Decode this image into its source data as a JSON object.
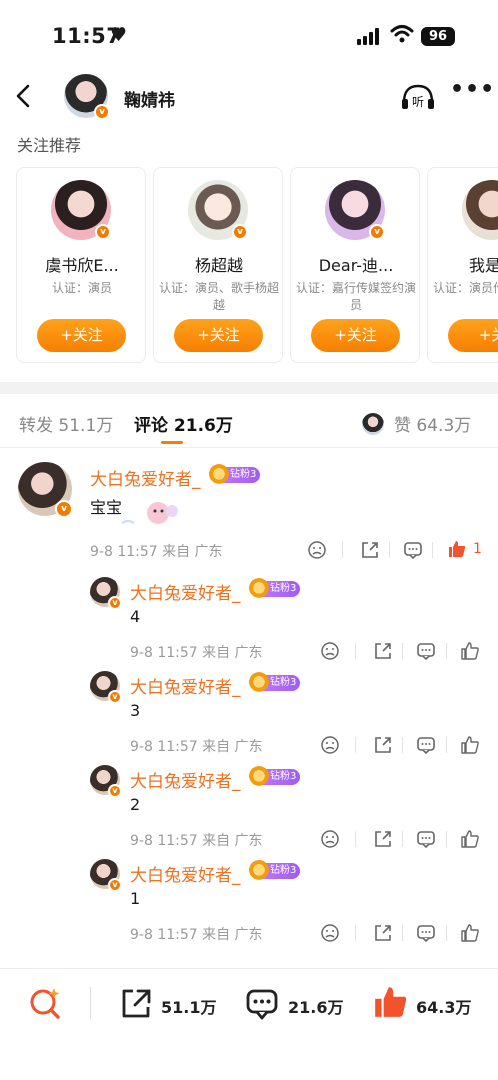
{
  "status": {
    "time": "11:57",
    "battery": "96"
  },
  "nav": {
    "title": "鞠婧祎",
    "listen_label": "听"
  },
  "recommend": {
    "title": "关注推荐",
    "cards": [
      {
        "name": "虞书欣E...",
        "cert": "认证：演员",
        "follow": "+关注"
      },
      {
        "name": "杨超越",
        "cert": "认证：演员、歌手杨超越",
        "follow": "+关注"
      },
      {
        "name": "Dear-迪...",
        "cert": "认证：嘉行传媒签约演员",
        "follow": "+关注"
      },
      {
        "name": "我是娇",
        "cert": "认证：演员作《玉茗茶",
        "follow": "+关"
      }
    ]
  },
  "tabs": {
    "repost": "转发 51.1万",
    "comment": "评论 21.6万",
    "like": "赞 64.3万"
  },
  "comments": [
    {
      "user": "大白兔爱好者_",
      "badge": "钻粉3",
      "text": "宝宝",
      "meta": "9-8 11:57 来自 广东",
      "likes": "1"
    }
  ],
  "replies": [
    {
      "user": "大白兔爱好者_",
      "badge": "钻粉3",
      "text": "4",
      "meta": "9-8 11:57 来自 广东"
    },
    {
      "user": "大白兔爱好者_",
      "badge": "钻粉3",
      "text": "3",
      "meta": "9-8 11:57 来自 广东"
    },
    {
      "user": "大白兔爱好者_",
      "badge": "钻粉3",
      "text": "2",
      "meta": "9-8 11:57 来自 广东"
    },
    {
      "user": "大白兔爱好者_",
      "badge": "钻粉3",
      "text": "1",
      "meta": "9-8 11:57 来自 广东"
    }
  ],
  "bottom": {
    "repost": "51.1万",
    "comment": "21.6万",
    "like": "64.3万"
  },
  "colors": {
    "accent": "#f77f00",
    "username": "#eb7321",
    "like_red": "#f2532a",
    "badge_purple": "#a15cf0"
  },
  "icons": [
    "heart-icon",
    "signal-icon",
    "wifi-icon",
    "back-icon",
    "listen-icon",
    "more-icon",
    "verified-icon",
    "dislike-icon",
    "share-icon",
    "comment-icon",
    "like-icon",
    "search-spark-icon"
  ]
}
